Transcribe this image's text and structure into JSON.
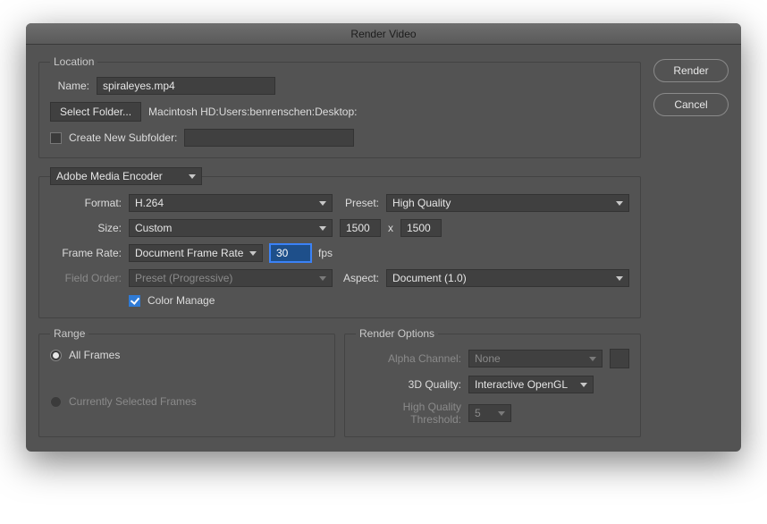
{
  "title": "Render Video",
  "side": {
    "render": "Render",
    "cancel": "Cancel"
  },
  "location": {
    "legend": "Location",
    "name_label": "Name:",
    "name_value": "spiraleyes.mp4",
    "select_folder": "Select Folder...",
    "path": "Macintosh HD:Users:benrenschen:Desktop:",
    "create_subfolder": "Create New Subfolder:",
    "subfolder_value": ""
  },
  "encoder": {
    "selector": "Adobe Media Encoder",
    "format_label": "Format:",
    "format_value": "H.264",
    "preset_label": "Preset:",
    "preset_value": "High Quality",
    "size_label": "Size:",
    "size_value": "Custom",
    "width": "1500",
    "sep": "x",
    "height": "1500",
    "fr_label": "Frame Rate:",
    "fr_value": "Document Frame Rate",
    "fps_value": "30",
    "fps_unit": "fps",
    "fo_label": "Field Order:",
    "fo_value": "Preset (Progressive)",
    "aspect_label": "Aspect:",
    "aspect_value": "Document (1.0)",
    "color_manage": "Color Manage"
  },
  "range": {
    "legend": "Range",
    "all": "All Frames",
    "sel": "Currently Selected Frames"
  },
  "ropts": {
    "legend": "Render Options",
    "alpha_label": "Alpha Channel:",
    "alpha_value": "None",
    "q_label": "3D Quality:",
    "q_value": "Interactive OpenGL",
    "hq_label": "High Quality Threshold:",
    "hq_value": "5"
  }
}
